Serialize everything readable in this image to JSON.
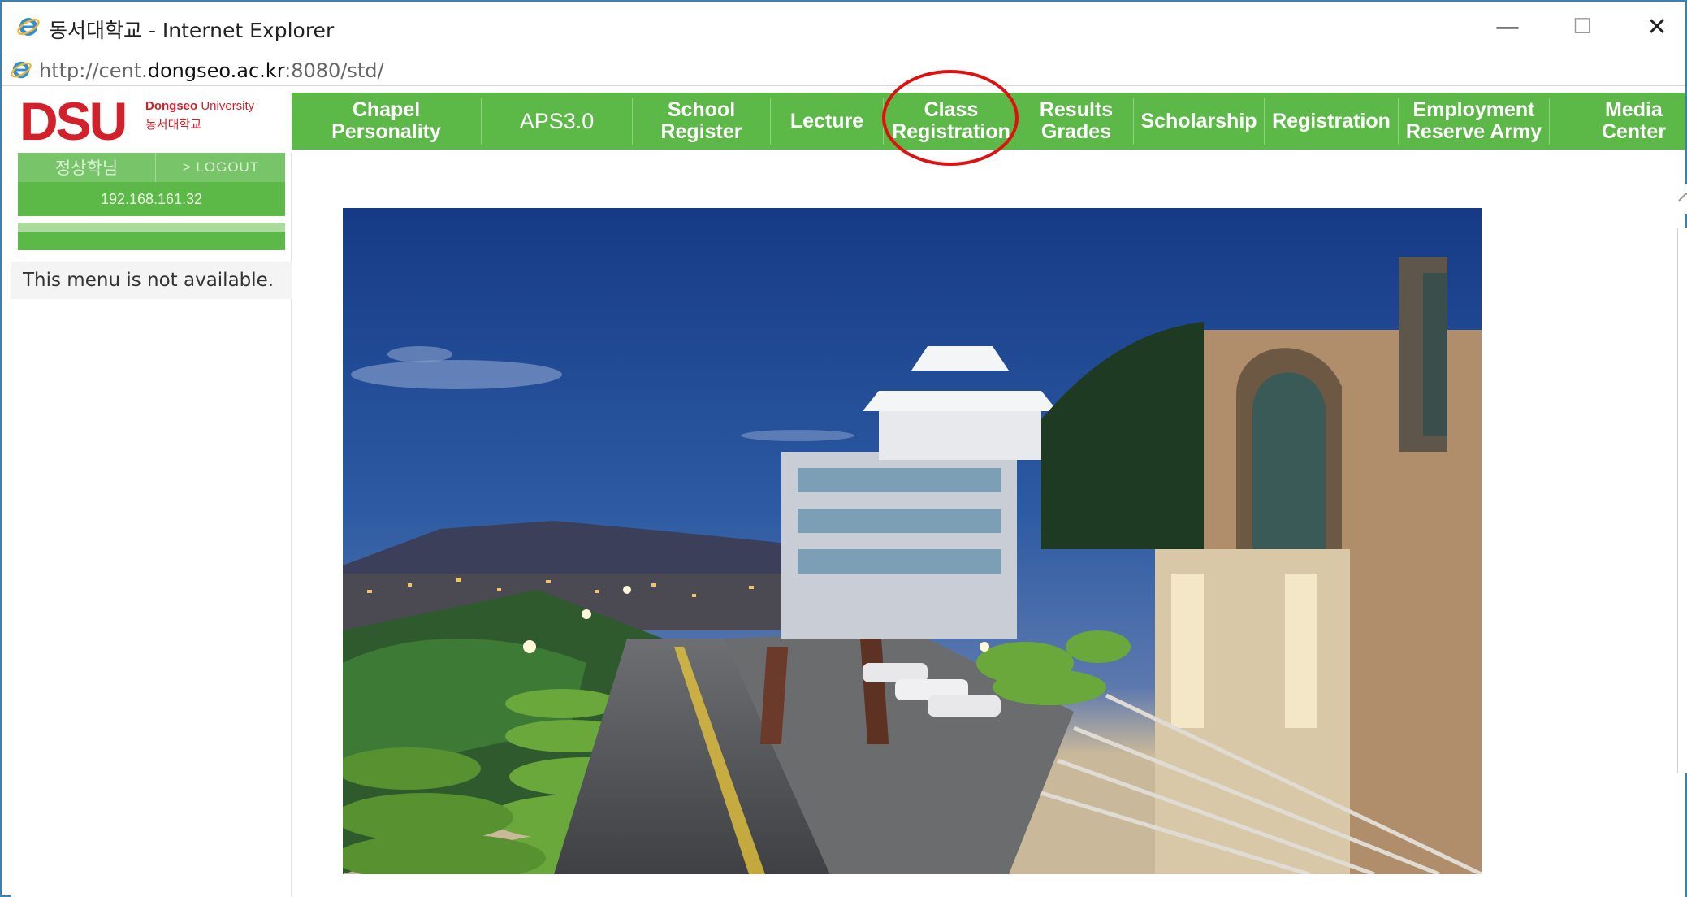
{
  "window": {
    "title": "동서대학교 - Internet Explorer",
    "minimize_glyph": "—",
    "maximize_glyph": "☐",
    "close_glyph": "✕"
  },
  "address": {
    "url_prefix": "http://cent.",
    "url_domain": "dongseo.ac.kr",
    "url_suffix": ":8080/std/"
  },
  "logo": {
    "mark": "DSU",
    "university_bold": "Dongseo",
    "university_rest": " University",
    "korean": "동서대학교"
  },
  "nav": {
    "items": [
      {
        "label": "Chapel\nPersonality"
      },
      {
        "label": "APS3.0"
      },
      {
        "label": "School\nRegister"
      },
      {
        "label": "Lecture"
      },
      {
        "label": "Class\nRegistration"
      },
      {
        "label": "Results\nGrades"
      },
      {
        "label": "Scholarship"
      },
      {
        "label": "Registration"
      },
      {
        "label": "Employment\nReserve Army"
      },
      {
        "label": "Media\nCenter"
      }
    ]
  },
  "sidebar": {
    "user_name": "정상학님",
    "logout_label": "> LOGOUT",
    "ip": "192.168.161.32",
    "notice": "This menu is not available."
  },
  "colors": {
    "nav_green": "#5cb847",
    "logo_red": "#d4202a",
    "annotation_red": "#e01010"
  },
  "icons": {
    "browser": "internet-explorer-icon",
    "scroll_up": "chevron-up-icon"
  }
}
